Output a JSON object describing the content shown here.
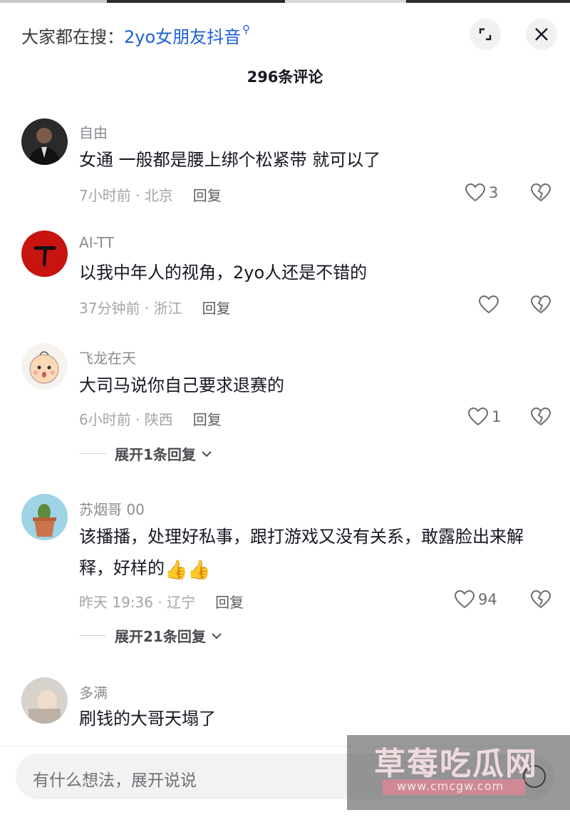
{
  "header": {
    "search_prefix": "大家都在搜：",
    "search_keyword": "2yo女朋友抖音"
  },
  "comment_count": "296条评论",
  "comments": [
    {
      "user": "自由",
      "text": "女通 一般都是腰上绑个松紧带 就可以了",
      "meta": "7小时前 · 北京",
      "reply": "回复",
      "likes": "3"
    },
    {
      "user": "AI-TT",
      "text": "以我中年人的视角，2yo人还是不错的",
      "meta": "37分钟前 · 浙江",
      "reply": "回复",
      "likes": ""
    },
    {
      "user": "飞龙在天",
      "text": "大司马说你自己要求退赛的",
      "meta": "6小时前 · 陕西",
      "reply": "回复",
      "likes": "1",
      "expand": "展开1条回复"
    },
    {
      "user": "苏烟哥 00",
      "text": "该播播，处理好私事，跟打游戏又没有关系，敢露脸出来解释，好样的",
      "meta": "昨天 19:36 · 辽宁",
      "reply": "回复",
      "likes": "94",
      "expand": "展开21条回复"
    },
    {
      "user": "多满",
      "text": "刷钱的大哥天塌了"
    }
  ],
  "input": {
    "placeholder": "有什么想法，展开说说"
  },
  "watermark": {
    "text": "草莓吃瓜网",
    "url": "www.cmcgw.com"
  },
  "colors": {
    "keyword": "#1d5fd6",
    "text": "#161823",
    "meta": "#a3a4a9"
  }
}
